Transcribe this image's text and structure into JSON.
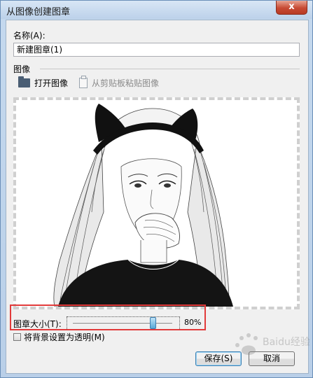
{
  "dialog": {
    "title": "从图像创建图章",
    "close_glyph": "x"
  },
  "name_section": {
    "label": "名称(A):",
    "value": "新建图章(1)"
  },
  "image_section": {
    "label": "图像",
    "open_label": "打开图像",
    "paste_label": "从剪贴板粘贴图像"
  },
  "size": {
    "label": "图章大小(T):",
    "value_text": "80%",
    "value": 0.8
  },
  "checkbox": {
    "label": "将背景设置为透明(M)",
    "checked": false
  },
  "buttons": {
    "save_label": "保存(S)",
    "cancel_label": "取消"
  },
  "watermark": {
    "text": "Baidu经验"
  },
  "icons": [
    "folder-icon",
    "paste-icon",
    "close-icon"
  ]
}
